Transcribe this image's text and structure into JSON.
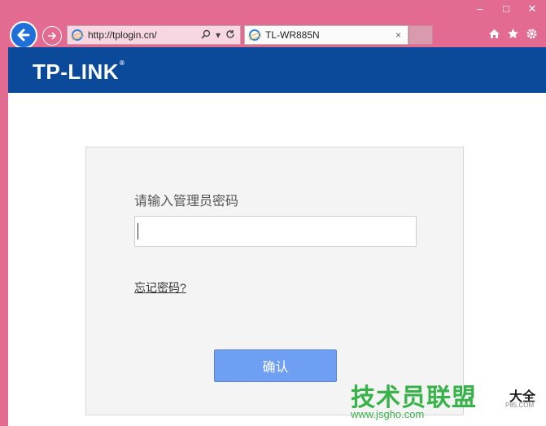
{
  "window": {
    "controls": [
      "–",
      "□",
      "✕"
    ]
  },
  "toolbar": {
    "back_icon": "back-arrow-icon",
    "forward_icon": "forward-arrow-icon",
    "address": "http://tplogin.cn/",
    "search_icon": "search-icon",
    "refresh_icon": "refresh-icon",
    "tab_title": "TL-WR885N",
    "tab_close": "×",
    "right_icons": [
      "home-icon",
      "star-icon",
      "gear-icon"
    ]
  },
  "page": {
    "brand": "TP-LINK",
    "brand_reg": "®",
    "prompt": "请输入管理员密码",
    "password_value": "",
    "forgot_link": "忘记密码?",
    "confirm_button": "确认"
  },
  "watermark": {
    "main": "技术员联盟",
    "side": "大全",
    "url": "www.jsgho.com",
    "url2": "P85.COM"
  },
  "colors": {
    "frame": "#e36b91",
    "brand_bar": "#0b4a9a",
    "button": "#6f9ff2",
    "watermark": "#38b34a"
  }
}
